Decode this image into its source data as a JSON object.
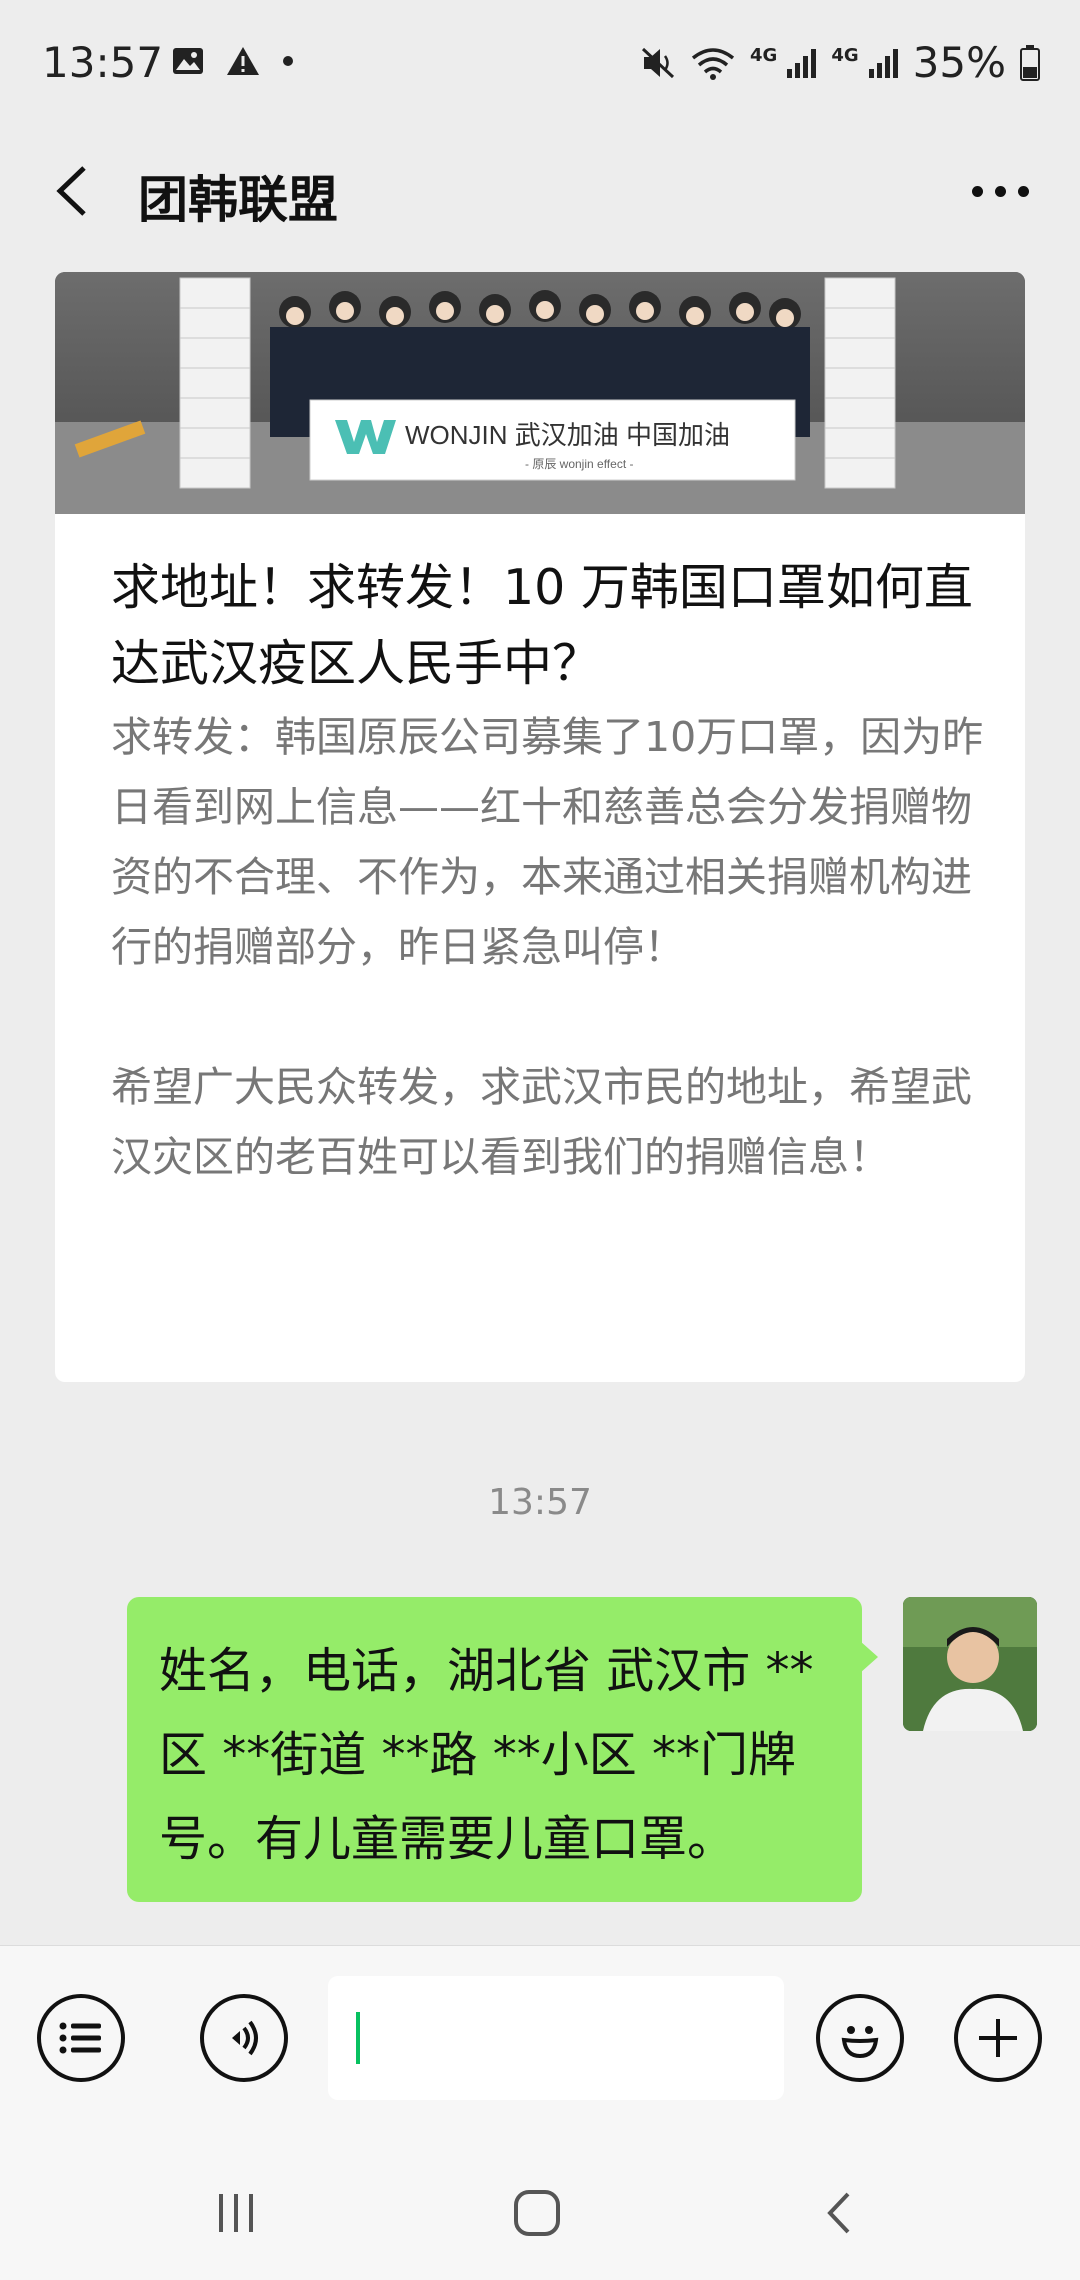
{
  "status_bar": {
    "time": "13:57",
    "icons": [
      "image-icon",
      "warning-icon",
      "dot-icon",
      "mute-icon",
      "wifi-icon",
      "signal-icon",
      "signal-icon"
    ],
    "network_label_1": "4G",
    "network_label_2": "4G",
    "battery": "35%"
  },
  "header": {
    "title": "团韩联盟",
    "back_icon": "chevron-left-icon",
    "more_icon": "more-icon"
  },
  "article": {
    "image_caption": "WONJIN 武汉加油 中国加油",
    "image_subcaption": "- 原辰 wonjin effect -",
    "title": "求地址！求转发！10 万韩国口罩如何直达武汉疫区人民手中？",
    "summary_p1": "求转发：韩国原辰公司募集了10万口罩，因为昨日看到网上信息——红十和慈善总会分发捐赠物资的不合理、不作为，本来通过相关捐赠机构进行的捐赠部分，昨日紧急叫停！",
    "summary_p2": "希望广大民众转发，求武汉市民的地址，希望武汉灾区的老百姓可以看到我们的捐赠信息！"
  },
  "time_divider": "13:57",
  "message": {
    "text": "姓名，电话，湖北省 武汉市 **区 **街道 **路 **小区 **门牌号。有儿童需要儿童口罩。"
  },
  "input_bar": {
    "value": "",
    "icons": [
      "menu-list-icon",
      "voice-icon",
      "emoji-icon",
      "plus-icon"
    ]
  },
  "nav_bar": {
    "icons": [
      "recent-apps-icon",
      "home-icon",
      "back-icon"
    ]
  },
  "colors": {
    "background": "#ededed",
    "bubble": "#95ec69",
    "caret": "#07c160"
  }
}
